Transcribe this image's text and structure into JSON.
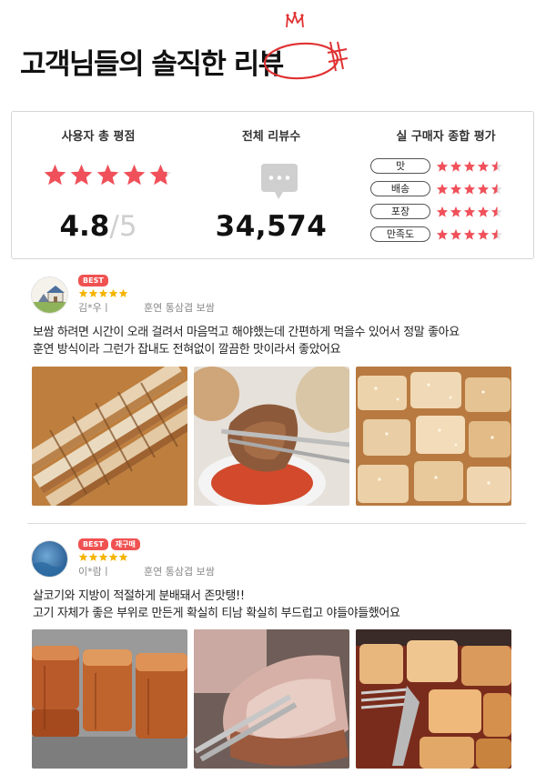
{
  "header": {
    "title_prefix": "고객님들의 솔직한 ",
    "title_highlight": "리뷰"
  },
  "summary": {
    "rating_label": "사용자 총 평점",
    "rating_value": "4.8",
    "rating_max": "/5",
    "rating_stars": 4.8,
    "count_label": "전체 리뷰수",
    "review_count": "34,574",
    "category_label": "실 구매자 종합 평가",
    "categories": [
      {
        "label": "맛",
        "stars": 4.5
      },
      {
        "label": "배송",
        "stars": 4.5
      },
      {
        "label": "포장",
        "stars": 4.5
      },
      {
        "label": "만족도",
        "stars": 4.5
      }
    ],
    "icons": {
      "stars": "star-icon",
      "bubble": "speech-bubble-icon"
    },
    "colors": {
      "star": "#f0505a",
      "star_empty": "#e3e3e3"
    }
  },
  "reviews": [
    {
      "badges": [
        "BEST"
      ],
      "stars": 5,
      "reviewer": "김*우ㅣ",
      "product": "훈연 통삼겹 보쌈",
      "text_line1": "보쌈 하려면 시간이 오래 걸려서 마음먹고 해야했는데 간편하게 먹을수 있어서 정말 좋아요",
      "text_line2": "훈연 방식이라 그런가 잡내도 전혀없이 깔끔한 맛이라서 좋았어요",
      "photos": [
        "sliced-pork-photo",
        "pork-with-chopsticks-photo",
        "sesame-pork-photo"
      ]
    },
    {
      "badges": [
        "BEST",
        "재구매"
      ],
      "stars": 5,
      "reviewer": "이*람ㅣ",
      "product": "훈연 통삼겹 보쌈",
      "text_line1": "살코기와 지방이 적절하게 분배돼서 존맛탱!!",
      "text_line2": "고기 자체가 좋은 부위로 만든게 확실히 티남 확실히 부드럽고 야들야들했어요",
      "photos": [
        "grilled-pork-photo",
        "pork-slice-closeup-photo",
        "pork-with-fork-photo"
      ]
    }
  ]
}
